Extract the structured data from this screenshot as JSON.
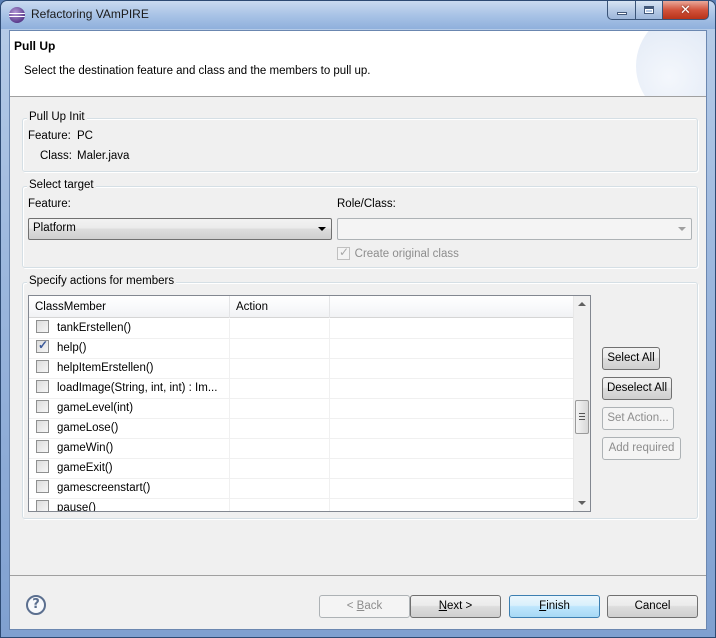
{
  "window": {
    "title": "Refactoring VAmPIRE",
    "icon": "eclipse-icon",
    "controls": {
      "minimize": "minimize",
      "maximize": "maximize",
      "close": "close"
    }
  },
  "header": {
    "title": "Pull Up",
    "description": "Select the destination feature and class and the members to pull up."
  },
  "pull_up_init": {
    "group_label": "Pull Up Init",
    "feature_label": "Feature:",
    "feature_value": "PC",
    "class_label": "Class:",
    "class_value": "Maler.java"
  },
  "select_target": {
    "group_label": "Select target",
    "feature_label": "Feature:",
    "feature_selected": "Platform",
    "role_class_label": "Role/Class:",
    "role_class_selected": "",
    "create_original_class_label": "Create original class",
    "create_original_class_checked": true,
    "create_original_class_enabled": false
  },
  "members": {
    "group_label": "Specify actions for members",
    "columns": [
      "ClassMember",
      "Action"
    ],
    "rows": [
      {
        "name": "tankErstellen()",
        "checked": false,
        "action": ""
      },
      {
        "name": "help()",
        "checked": true,
        "action": ""
      },
      {
        "name": "helpItemErstellen()",
        "checked": false,
        "action": ""
      },
      {
        "name": "loadImage(String, int, int) : Im...",
        "checked": false,
        "action": ""
      },
      {
        "name": "gameLevel(int)",
        "checked": false,
        "action": ""
      },
      {
        "name": "gameLose()",
        "checked": false,
        "action": ""
      },
      {
        "name": "gameWin()",
        "checked": false,
        "action": ""
      },
      {
        "name": "gameExit()",
        "checked": false,
        "action": ""
      },
      {
        "name": "gamescreenstart()",
        "checked": false,
        "action": ""
      },
      {
        "name": "pause()",
        "checked": false,
        "action": ""
      }
    ],
    "buttons": {
      "select_all": "Select All",
      "deselect_all": "Deselect All",
      "set_action": "Set Action...",
      "add_required": "Add required"
    }
  },
  "footer": {
    "help_icon": "help-icon",
    "back": {
      "pre": "< ",
      "mnemonic": "B",
      "post": "ack"
    },
    "next": {
      "pre": "",
      "mnemonic": "N",
      "post": "ext >"
    },
    "finish": {
      "pre": "",
      "mnemonic": "F",
      "post": "inish"
    },
    "cancel": "Cancel"
  }
}
